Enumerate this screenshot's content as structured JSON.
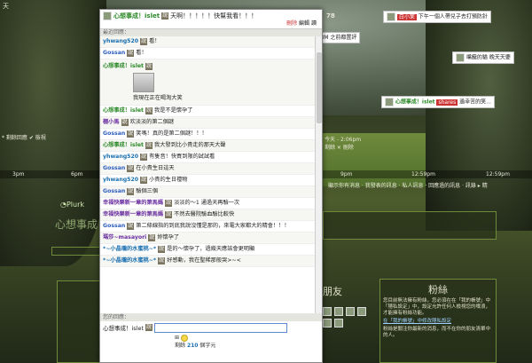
{
  "top": {
    "left_text": "天",
    "number": "78",
    "status_left": "* 剩餘回應 ✔ 檢視"
  },
  "timebar": [
    "3pm",
    "6pm",
    "9pm",
    "12:59pm",
    "12:59pm"
  ],
  "profile": {
    "plurk_label": "Plurk",
    "title": "心想事成",
    "friends_label": "朋友",
    "fans_label": "粉絲",
    "fans_desc": "您目前無法擁有粉絲，您必須在在「我的帳號」中「隱私設定」中，設定允許任何人檢視您的噗浪，才能擁有粉絲功能。",
    "fans_link": "在「我的帳號」中修改隱私設定",
    "fans_note": "粉絲是關注你最新的消息，而不在你的朋友清單中的人。"
  },
  "tabs_right": "顯示你有消息 · 我發表的訊息 · 私人訊息 · 回應過的訊息 · 訊錄 ▸ 精",
  "chat": {
    "header": {
      "name": "心想事成！islet",
      "badge": "說",
      "text": "天啊！！！！！快幫我看！！！",
      "delete": "刪除",
      "edit": "編輯",
      "more": "讀"
    },
    "section_label": "最近回應：",
    "rows": [
      {
        "name": "yhwang520",
        "badge": "說",
        "text": "看！",
        "style": "name"
      },
      {
        "name": "Gossan",
        "badge": "說",
        "text": "看！",
        "style": "name-blue"
      },
      {
        "name": "心想事成！islet",
        "badge": "說",
        "text": "我現在正在喝淘大笑",
        "style": "name-green",
        "image": true
      },
      {
        "name": "心想事成！islet",
        "badge": "說",
        "text": "我是不是懷孕了",
        "style": "name-green"
      },
      {
        "name": "棚小馬",
        "badge": "說",
        "text": "欢淡淡的第二個謎",
        "style": "name-purple"
      },
      {
        "name": "Gossan",
        "badge": "說",
        "text": "笑嗎！真的是第二個謎！！！",
        "style": "name-blue"
      },
      {
        "name": "心想事成！islet",
        "badge": "說",
        "text": "我大發到比小貴走的那天大聲",
        "style": "name-green"
      },
      {
        "name": "yhwang520",
        "badge": "說",
        "text": "有隻音！快買到限的試試看",
        "style": "name"
      },
      {
        "name": "Gossan",
        "badge": "說",
        "text": "在小貴生日這天",
        "style": "name-blue"
      },
      {
        "name": "yhwang520",
        "badge": "說",
        "text": "小貴的生日禮物",
        "style": "name"
      },
      {
        "name": "Gossan",
        "badge": "說",
        "text": "驗個三個",
        "style": "name-blue"
      },
      {
        "name": "幸福快樂新一章的第馬媽",
        "badge": "說",
        "text": "淡淡的～1 通過天再驗一次",
        "style": "name-purple"
      },
      {
        "name": "幸福快樂新一章的第馬媽",
        "badge": "說",
        "text": "不然去醫院驗血驗比較快",
        "style": "name-purple"
      },
      {
        "name": "Gossan",
        "badge": "說",
        "text": "第二條線指的到底我說沒懂是那的，來電大家都大的精會！！！",
        "style": "name-blue"
      },
      {
        "name": "瑪莎~masayori",
        "badge": "說",
        "text": "妳懷孕了",
        "style": "name-purple"
      },
      {
        "name": "*~小晶瓏的水蜜桃~*",
        "badge": "說",
        "text": "是的～懷孕了，過幾天應該會更明顯",
        "style": "name"
      },
      {
        "name": "*~小晶瓏的水蜜桃~*",
        "badge": "說",
        "text": "好感動，我在聖稀那般哭>~<",
        "style": "name"
      }
    ],
    "reply_label": "您的回應：",
    "reply_name": "心想事成！islet",
    "reply_badge": "說",
    "reply_placeholder": "",
    "reply_counter_label": "剩餘",
    "reply_counter": "210",
    "reply_counter_unit": "個字元"
  },
  "right": {
    "notif1_name": "白小茉",
    "notif1_text": "下午一個人帶兒子去打預防針",
    "notif2_text": "2Y3M 之前都置評",
    "notif3_name": "嘴饞的貓",
    "notif3_text": "晚天天要",
    "notif4_name": "心想事成！islet",
    "notif4_pill": "shares",
    "notif4_text": "過幸苦的笑...",
    "time_label": "今天 - 2:06pm",
    "reply_count": "剩餘 ✕ 刪除"
  }
}
